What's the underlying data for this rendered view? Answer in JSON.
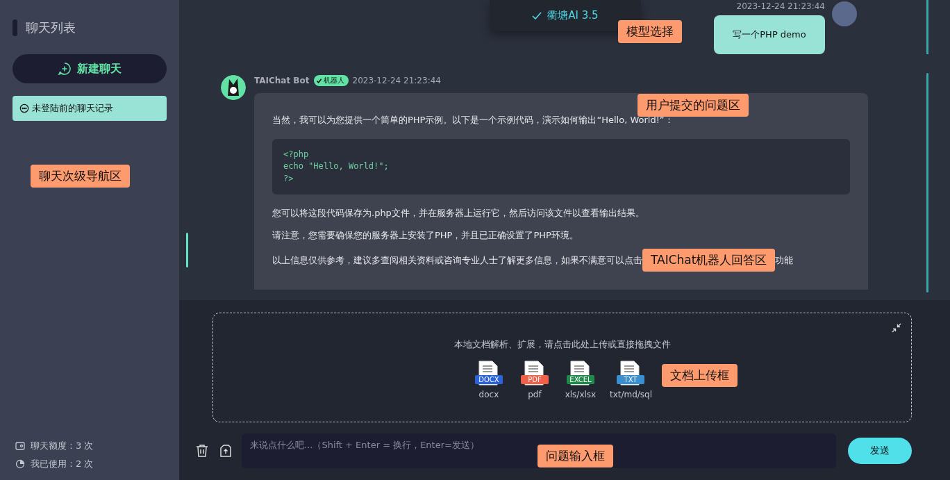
{
  "sidebar": {
    "title": "聊天列表",
    "new_chat_button": "新建聊天",
    "history": [
      {
        "label": "未登陆前的聊天记录",
        "selected": true
      }
    ],
    "quota": [
      {
        "kind": "wallet",
        "label": "聊天额度：3 次"
      },
      {
        "kind": "pie",
        "label": "我已使用：2 次"
      }
    ]
  },
  "model_menu": {
    "items": [
      {
        "label": "衢塘AI 3.5",
        "selected": true
      }
    ]
  },
  "messages": [
    {
      "kind": "user",
      "time": "2023-12-24 21:23:44",
      "text": "写一个PHP demo"
    },
    {
      "kind": "bot",
      "name": "TAIChat Bot",
      "badge": "机器人",
      "time": "2023-12-24 21:23:44",
      "paragraphs": [
        {
          "kind": "text",
          "text": "当然，我可以为您提供一个简单的PHP示例。以下是一个示例代码，演示如何输出“Hello, World!”："
        },
        {
          "kind": "code",
          "text": "<?php\necho \"Hello, World!\";\n?>"
        },
        {
          "kind": "text",
          "text": "您可以将这段代码保存为.php文件，并在服务器上运行它，然后访问该文件以查看输出结果。"
        },
        {
          "kind": "text",
          "text": "请注意，您需要确保您的服务器上安装了PHP，并且已正确设置了PHP环境。"
        },
        {
          "kind": "annotated",
          "before": "以上信息仅供参考，建议多查阅相关资料或咨询专业人士了解更多信息，如果不满意可以点击",
          "note": "TAIChat机器人回答区",
          "after": "功能"
        }
      ]
    }
  ],
  "upload": {
    "hint": "本地文档解析、扩展，请点击此处上传或直接拖拽文件",
    "file_types": [
      {
        "kind": "docx",
        "tag": "DOCX",
        "label": "docx"
      },
      {
        "kind": "pdf",
        "tag": "PDF",
        "label": "pdf"
      },
      {
        "kind": "excel",
        "tag": "EXCEL",
        "label": "xls/xlsx"
      },
      {
        "kind": "txt",
        "tag": "TXT",
        "label": "txt/md/sql"
      }
    ]
  },
  "composer": {
    "placeholder": "来说点什么吧...（Shift + Enter = 换行，Enter=发送）",
    "send_button": "发送"
  },
  "annotations": [
    {
      "kind": "model",
      "text": "模型选择"
    },
    {
      "kind": "question",
      "text": "用户提交的问题区"
    },
    {
      "kind": "nav",
      "text": "聊天次级导航区"
    },
    {
      "kind": "upload",
      "text": "文档上传框"
    },
    {
      "kind": "input",
      "text": "问题输入框"
    }
  ]
}
